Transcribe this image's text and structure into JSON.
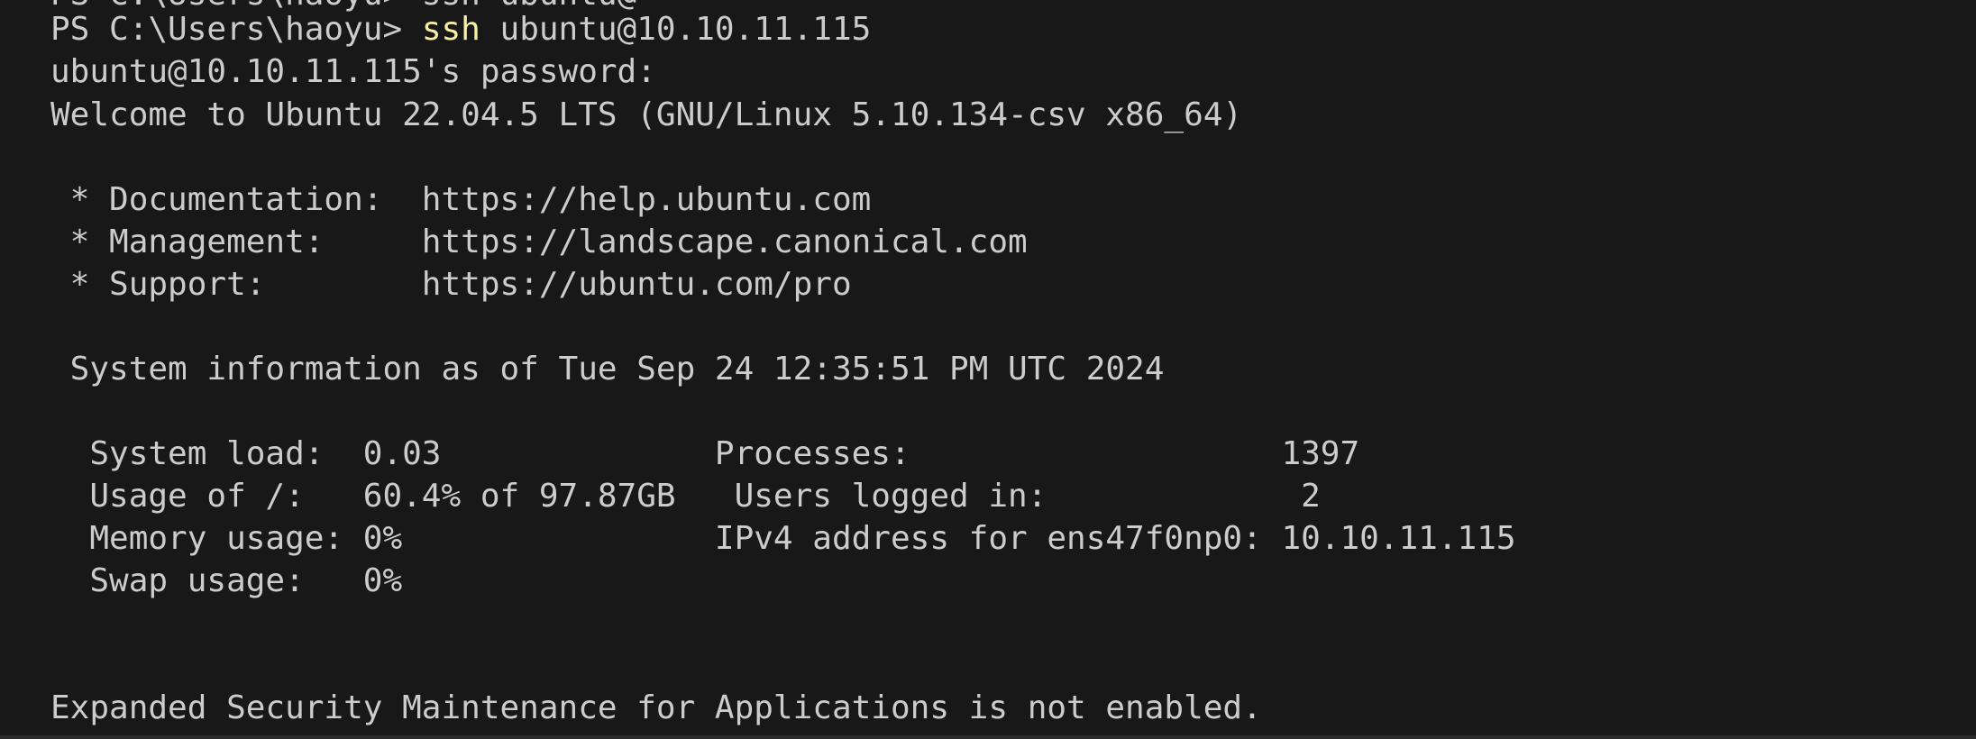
{
  "terminal": {
    "cropped_top_line": "PS C:\\Users\\haoyu> ssh ubuntu@",
    "prompt": {
      "path": "PS C:\\Users\\haoyu> ",
      "command": "ssh",
      "argument": " ubuntu@10.10.11.115"
    },
    "password_prompt": "ubuntu@10.10.11.115's password:",
    "welcome": "Welcome to Ubuntu 22.04.5 LTS (GNU/Linux 5.10.134-csv x86_64)",
    "links": [
      " * Documentation:  https://help.ubuntu.com",
      " * Management:     https://landscape.canonical.com",
      " * Support:        https://ubuntu.com/pro"
    ],
    "sysinfo_header": " System information as of Tue Sep 24 12:35:51 PM UTC 2024",
    "sysinfo_rows": [
      "  System load:  0.03              Processes:                   1397",
      "  Usage of /:   60.4% of 97.87GB   Users logged in:             2",
      "  Memory usage: 0%                IPv4 address for ens47f0np0: 10.10.11.115",
      "  Swap usage:   0%"
    ],
    "esm_notice": "Expanded Security Maintenance for Applications is not enabled."
  },
  "colors": {
    "background": "#181818",
    "text": "#cccccc",
    "command": "#f9f1a5"
  }
}
